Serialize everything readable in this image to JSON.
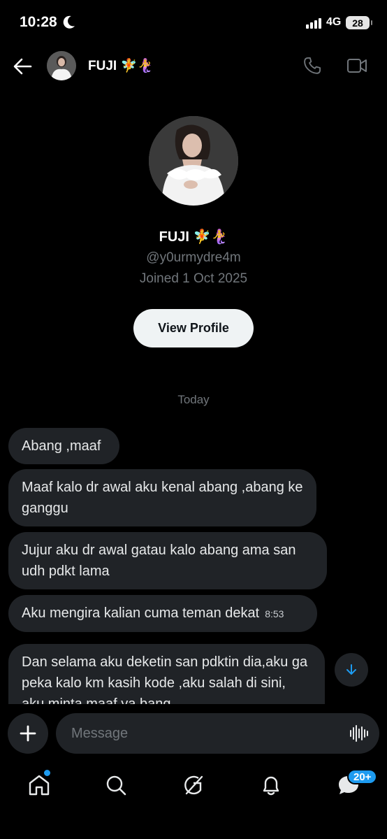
{
  "status_bar": {
    "time": "10:28",
    "network": "4G",
    "battery": "28"
  },
  "header": {
    "name": "FUJI 🧚🧜‍♀️"
  },
  "profile": {
    "name": "FUJI 🧚🧜‍♀️",
    "handle": "@y0urmydre4m",
    "joined": "Joined 1 Oct 2025",
    "view_profile_label": "View Profile"
  },
  "date_separator": "Today",
  "messages": [
    {
      "text": "Abang ,maaf"
    },
    {
      "text": "Maaf kalo dr awal aku kenal abang ,abang ke ganggu"
    },
    {
      "text": "Jujur aku dr awal gatau kalo abang ama san udh pdkt lama"
    },
    {
      "text": "Aku mengira kalian cuma teman dekat",
      "time": "8:53"
    },
    {
      "text": "Dan selama aku deketin san pdktin dia,aku ga peka  kalo km kasih kode ,aku salah di sini, aku minta maaf ya bang"
    }
  ],
  "composer": {
    "placeholder": "Message"
  },
  "bottom_nav": {
    "messages_badge": "20+"
  },
  "colors": {
    "background": "#000000",
    "bubble": "#202327",
    "accent": "#1d9bf0",
    "muted_text": "#71767b"
  },
  "icons": [
    "back-arrow-icon",
    "phone-icon",
    "video-icon",
    "plus-icon",
    "voice-icon",
    "home-icon",
    "search-icon",
    "grok-icon",
    "bell-icon",
    "messages-icon",
    "arrow-down-icon",
    "moon-icon"
  ]
}
